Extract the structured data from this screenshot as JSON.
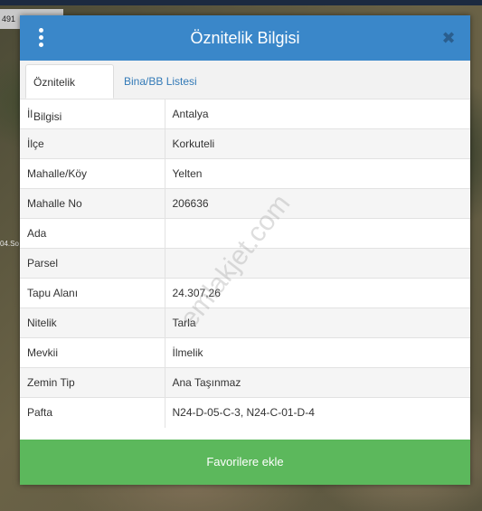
{
  "map": {
    "coord_chip": "491",
    "road_label": "04.So"
  },
  "dialog": {
    "title": "Öznitelik Bilgisi",
    "close_glyph": "✖",
    "watermark": "emlakjet.com"
  },
  "tabs": [
    {
      "label": "Öznitelik Bilgisi",
      "active": true
    },
    {
      "label": "Bina/BB Listesi",
      "active": false
    }
  ],
  "rows": [
    {
      "key": "İl",
      "value": "Antalya"
    },
    {
      "key": "İlçe",
      "value": "Korkuteli"
    },
    {
      "key": "Mahalle/Köy",
      "value": "Yelten"
    },
    {
      "key": "Mahalle No",
      "value": "206636"
    },
    {
      "key": "Ada",
      "value": ""
    },
    {
      "key": "Parsel",
      "value": ""
    },
    {
      "key": "Tapu Alanı",
      "value": "24.307,26"
    },
    {
      "key": "Nitelik",
      "value": "Tarla"
    },
    {
      "key": "Mevkii",
      "value": "İlmelik"
    },
    {
      "key": "Zemin Tip",
      "value": "Ana Taşınmaz"
    },
    {
      "key": "Pafta",
      "value": "N24-D-05-C-3, N24-C-01-D-4"
    }
  ],
  "favorites_button": "Favorilere ekle",
  "colors": {
    "header": "#3a87c9",
    "button": "#5cb85c",
    "tab_link": "#337ab7"
  },
  "icons": {
    "menu": "vertical-ellipsis-icon",
    "close": "close-icon"
  }
}
